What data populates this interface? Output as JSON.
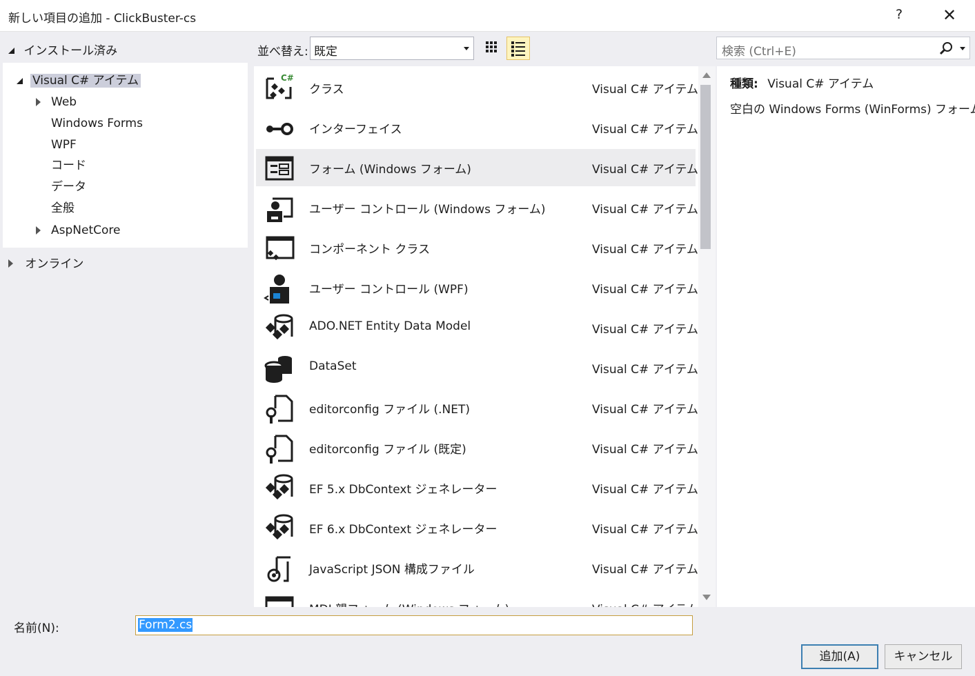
{
  "window": {
    "title": "新しい項目の追加 - ClickBuster-cs",
    "help_label": "?",
    "close_label": "✕"
  },
  "tree": {
    "installed_label": "インストール済み",
    "items": [
      {
        "label": "Visual C# アイテム",
        "selected": true
      },
      {
        "label": "Web"
      },
      {
        "label": "Windows Forms"
      },
      {
        "label": "WPF"
      },
      {
        "label": "コード"
      },
      {
        "label": "データ"
      },
      {
        "label": "全般"
      },
      {
        "label": "AspNetCore"
      }
    ],
    "online_label": "オンライン"
  },
  "toolbar": {
    "sort_label": "並べ替え:",
    "sort_value": "既定",
    "view_small_icons": "small-icons-view",
    "view_list": "list-view"
  },
  "search": {
    "placeholder": "検索 (Ctrl+E)"
  },
  "items": [
    {
      "name": "クラス",
      "category": "Visual C# アイテム",
      "icon": "class-icon"
    },
    {
      "name": "インターフェイス",
      "category": "Visual C# アイテム",
      "icon": "interface-icon"
    },
    {
      "name": "フォーム (Windows フォーム)",
      "category": "Visual C# アイテム",
      "icon": "form-icon",
      "selected": true
    },
    {
      "name": "ユーザー コントロール (Windows フォーム)",
      "category": "Visual C# アイテム",
      "icon": "user-control-icon"
    },
    {
      "name": "コンポーネント クラス",
      "category": "Visual C# アイテム",
      "icon": "component-class-icon"
    },
    {
      "name": "ユーザー コントロール (WPF)",
      "category": "Visual C# アイテム",
      "icon": "wpf-user-control-icon"
    },
    {
      "name": "ADO.NET Entity Data Model",
      "category": "Visual C# アイテム",
      "icon": "entity-model-icon"
    },
    {
      "name": "DataSet",
      "category": "Visual C# アイテム",
      "icon": "dataset-icon"
    },
    {
      "name": "editorconfig ファイル (.NET)",
      "category": "Visual C# アイテム",
      "icon": "config-file-icon"
    },
    {
      "name": "editorconfig ファイル (既定)",
      "category": "Visual C# アイテム",
      "icon": "config-file-icon"
    },
    {
      "name": "EF 5.x DbContext ジェネレーター",
      "category": "Visual C# アイテム",
      "icon": "entity-model-icon"
    },
    {
      "name": "EF 6.x DbContext ジェネレーター",
      "category": "Visual C# アイテム",
      "icon": "entity-model-icon"
    },
    {
      "name": "JavaScript JSON 構成ファイル",
      "category": "Visual C# アイテム",
      "icon": "json-file-icon"
    },
    {
      "name": "MDI 親フォーム (Windows フォーム)",
      "category": "Visual C# アイテム",
      "icon": "form-icon"
    }
  ],
  "detail": {
    "kind_label": "種類:",
    "kind_value": "Visual C# アイテム",
    "description": "空白の Windows Forms (WinForms) フォーム"
  },
  "footer": {
    "name_label": "名前(N):",
    "name_value": "Form2.cs",
    "add_label": "追加(A)",
    "cancel_label": "キャンセル"
  },
  "colors": {
    "accent_green": "#388a34",
    "selection": "#cccedb",
    "focus_border": "#3c7fb1",
    "input_highlight": "#3399ff"
  }
}
